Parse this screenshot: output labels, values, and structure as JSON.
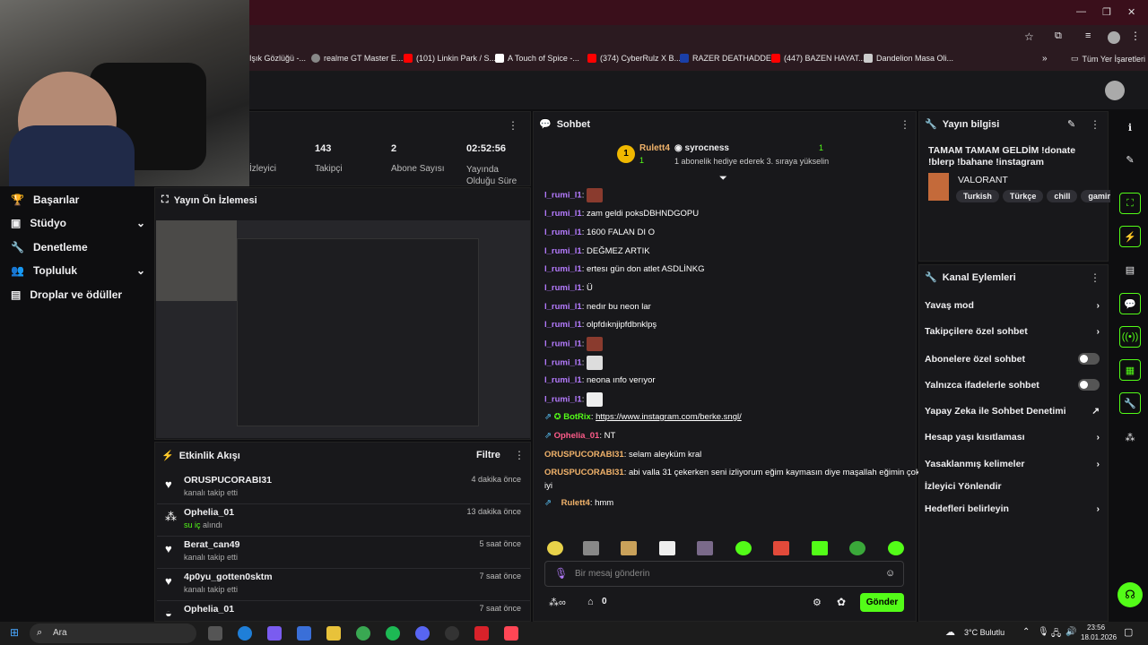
{
  "browser": {
    "bookmarks": [
      "Işık Gözlüğü -...",
      "realme GT Master E...",
      "(101) Linkin Park / S...",
      "A Touch of Spice -...",
      "(374) CyberRulz X B...",
      "RAZER DEATHADDE...",
      "(447) BAZEN HAYAT...",
      "Dandelion Masa Oli...",
      "Tüm Yer İşaretleri"
    ]
  },
  "stats": {
    "viewers_label": "İzleyici",
    "followers_value": "143",
    "followers_label": "Takipçi",
    "subs_value": "2",
    "subs_label": "Abone Sayısı",
    "uptime_value": "02:52:56",
    "uptime_label": "Yayında Olduğu Süre"
  },
  "sidebar": {
    "items": [
      {
        "label": "Başarılar"
      },
      {
        "label": "Stüdyo"
      },
      {
        "label": "Denetleme"
      },
      {
        "label": "Topluluk"
      },
      {
        "label": "Droplar ve ödüller"
      }
    ]
  },
  "preview": {
    "title": "Yayın Ön İzlemesi"
  },
  "events": {
    "title": "Etkinlik Akışı",
    "filter_label": "Filtre",
    "rows": [
      {
        "name": "ORUSPUCORABI31",
        "sub": "kanalı takip etti",
        "time": "4 dakika önce"
      },
      {
        "name": "Ophelia_01",
        "sub": "su iç",
        "sub2": "alındı",
        "time": "13 dakika önce"
      },
      {
        "name": "Berat_can49",
        "sub": "kanalı takip etti",
        "time": "5 saat önce"
      },
      {
        "name": "4p0yu_gotten0sktm",
        "sub": "kanalı takip etti",
        "time": "7 saat önce"
      },
      {
        "name": "Ophelia_01",
        "sub": "",
        "time": "7 saat önce"
      }
    ]
  },
  "chat": {
    "title": "Sohbet",
    "pinned": {
      "rank": "1",
      "user1": "Rulett4",
      "count1": "1",
      "user2": "syrocness",
      "count2": "1",
      "desc": "1 abonelik hediye ederek 3. sıraya yükselin"
    },
    "messages": [
      {
        "user": "l_rumi_l1",
        "text": "",
        "emote": true
      },
      {
        "user": "l_rumi_l1",
        "text": "zam geldi poksDBHNDGOPU"
      },
      {
        "user": "l_rumi_l1",
        "text": "1600 FALAN DI O"
      },
      {
        "user": "l_rumi_l1",
        "text": "DEĞMEZ ARTIK"
      },
      {
        "user": "l_rumi_l1",
        "text": "ertesı gün don atlet ASDLİNKG"
      },
      {
        "user": "l_rumi_l1",
        "text": "Ü"
      },
      {
        "user": "l_rumi_l1",
        "text": "nedır bu neon lar"
      },
      {
        "user": "l_rumi_l1",
        "text": "olpfdıknjipfdbnklpş"
      },
      {
        "user": "l_rumi_l1",
        "text": "",
        "emote": true
      },
      {
        "user": "l_rumi_l1",
        "text": "",
        "emote": true
      },
      {
        "user": "l_rumi_l1",
        "text": "neona ınfo verıyor"
      },
      {
        "user": "l_rumi_l1",
        "text": "",
        "emote": true
      },
      {
        "user": "BotRix",
        "text": "https://www.instagram.com/berke.sngl/"
      },
      {
        "user": "Ophelia_01",
        "text": "NT"
      },
      {
        "user": "ORUSPUCORABI31",
        "text": "selam aleyküm kral"
      },
      {
        "user": "ORUSPUCORABI31",
        "text": "abi valla 31 çekerken seni izliyorum eğim kaymasın diye maşallah eğimin çok"
      },
      {
        "user": "",
        "text": "iyi"
      },
      {
        "user": "Rulett4",
        "text": "hmm"
      }
    ],
    "input_placeholder": "Bir mesaj gönderin",
    "points": "0",
    "send_label": "Gönder"
  },
  "stream_info": {
    "title": "Yayın bilgisi",
    "stream_title": "TAMAM TAMAM GELDİM !donate !blerp !bahane !instagram",
    "category": "VALORANT",
    "tags": [
      "Turkish",
      "Türkçe",
      "chill",
      "gaming"
    ]
  },
  "channel_actions": {
    "title": "Kanal Eylemleri",
    "items": [
      {
        "label": "Yavaş mod",
        "type": "arrow"
      },
      {
        "label": "Takipçilere özel sohbet",
        "type": "arrow"
      },
      {
        "label": "Abonelere özel sohbet",
        "type": "toggle"
      },
      {
        "label": "Yalnızca ifadelerle sohbet",
        "type": "toggle"
      },
      {
        "label": "Yapay Zeka ile Sohbet Denetimi",
        "type": "ext"
      },
      {
        "label": "Hesap yaşı kısıtlaması",
        "type": "arrow"
      },
      {
        "label": "Yasaklanmış kelimeler",
        "type": "arrow"
      },
      {
        "label": "İzleyici Yönlendir",
        "type": "none"
      },
      {
        "label": "Hedefleri belirleyin",
        "type": "arrow"
      }
    ]
  },
  "taskbar": {
    "search": "Ara",
    "weather": "3°C Bulutlu",
    "time": "23:56",
    "date": "18.01.2026"
  },
  "colors": {
    "accent": "#53fc18",
    "browser_title": "#3a0f1b"
  }
}
